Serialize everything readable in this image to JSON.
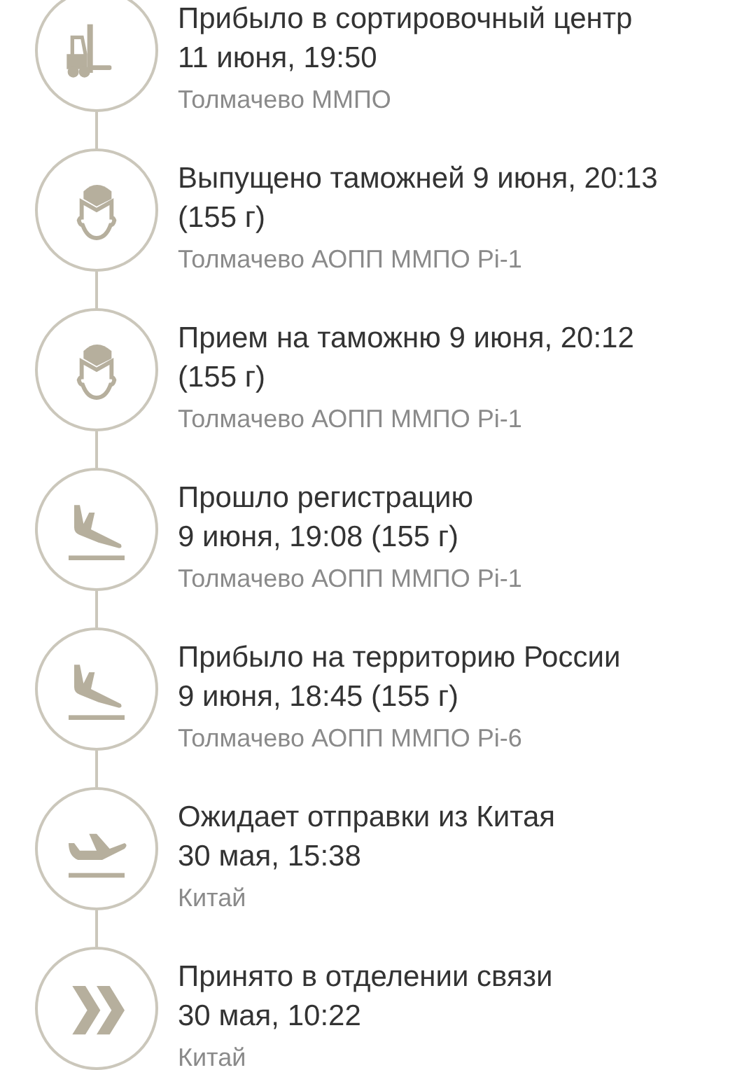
{
  "events": [
    {
      "kind": "forklift",
      "heading": "Прибыло в сортировочный центр",
      "detail": "11 июня, 19:50",
      "location": "Толмачево ММПО"
    },
    {
      "kind": "officer",
      "heading": "Выпущено таможней 9 июня, 20:13",
      "detail": "(155 г)",
      "location": "Толмачево АОПП ММПО Pi-1"
    },
    {
      "kind": "officer",
      "heading": "Прием на таможню 9 июня, 20:12",
      "detail": "(155 г)",
      "location": "Толмачево АОПП ММПО Pi-1"
    },
    {
      "kind": "landing",
      "heading": "Прошло регистрацию",
      "detail": "9 июня, 19:08 (155 г)",
      "location": "Толмачево АОПП ММПО Pi-1"
    },
    {
      "kind": "landing",
      "heading": "Прибыло на территорию России",
      "detail": "9 июня, 18:45 (155 г)",
      "location": "Толмачево АОПП ММПО Pi-6"
    },
    {
      "kind": "takeoff",
      "heading": "Ожидает отправки из Китая",
      "detail": "30 мая, 15:38",
      "location": "Китай"
    },
    {
      "kind": "chevrons",
      "heading": "Принято в отделении связи",
      "detail": "30 мая, 10:22",
      "location": "Китай"
    }
  ]
}
